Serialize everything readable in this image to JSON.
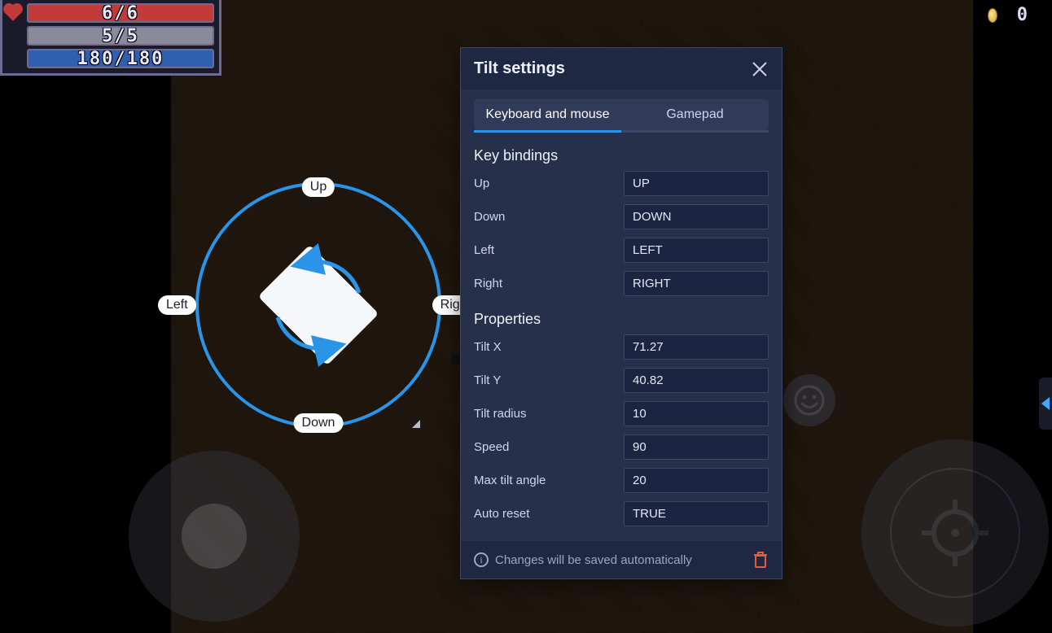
{
  "hud": {
    "hp": "6/6",
    "armor": "5/5",
    "mana": "180/180"
  },
  "coins": "0",
  "tilt_overlay": {
    "up": "Up",
    "down": "Down",
    "left": "Left",
    "right": "Right"
  },
  "panel": {
    "title": "Tilt settings",
    "tabs": {
      "keyboard": "Keyboard and mouse",
      "gamepad": "Gamepad"
    },
    "keybindings_header": "Key bindings",
    "keys": {
      "up_label": "Up",
      "up_value": "UP",
      "down_label": "Down",
      "down_value": "DOWN",
      "left_label": "Left",
      "left_value": "LEFT",
      "right_label": "Right",
      "right_value": "RIGHT"
    },
    "props_header": "Properties",
    "props": {
      "tilt_x_label": "Tilt X",
      "tilt_x_value": "71.27",
      "tilt_y_label": "Tilt Y",
      "tilt_y_value": "40.82",
      "tilt_radius_label": "Tilt radius",
      "tilt_radius_value": "10",
      "speed_label": "Speed",
      "speed_value": "90",
      "max_angle_label": "Max tilt angle",
      "max_angle_value": "20",
      "auto_reset_label": "Auto reset",
      "auto_reset_value": "TRUE"
    },
    "footer_text": "Changes will be saved automatically"
  }
}
